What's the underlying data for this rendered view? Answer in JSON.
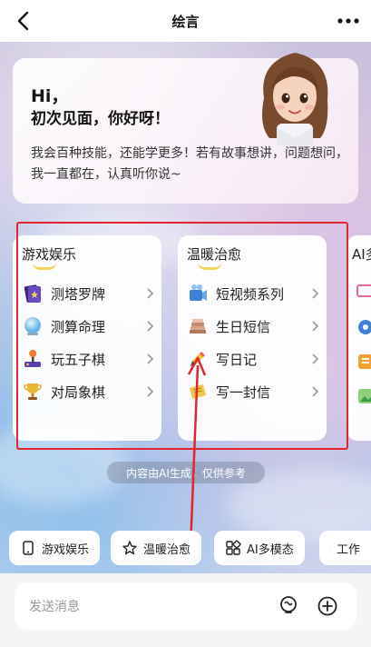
{
  "header": {
    "title": "绘言"
  },
  "greeting": {
    "hi": "Hi，",
    "meet": "初次见面，你好呀！",
    "intro": "我会百种技能，还能学更多！若有故事想讲，问题想问，我一直都在，认真听你说~"
  },
  "cards": [
    {
      "title": "游戏娱乐",
      "items": [
        {
          "label": "测塔罗牌",
          "icon": "tarot-icon"
        },
        {
          "label": "测算命理",
          "icon": "crystal-ball-icon"
        },
        {
          "label": "玩五子棋",
          "icon": "joystick-icon"
        },
        {
          "label": "对局象棋",
          "icon": "trophy-icon"
        }
      ]
    },
    {
      "title": "温暖治愈",
      "items": [
        {
          "label": "短视频系列",
          "icon": "video-icon"
        },
        {
          "label": "生日短信",
          "icon": "books-icon"
        },
        {
          "label": "写日记",
          "icon": "pencil-icon"
        },
        {
          "label": "写一封信",
          "icon": "ticket-icon"
        }
      ]
    }
  ],
  "partial_card": {
    "title": "AI多"
  },
  "disclaimer": "内容由AI生成，仅供参考",
  "chips": [
    {
      "label": "游戏娱乐",
      "icon": "phone-icon"
    },
    {
      "label": "温暖治愈",
      "icon": "star-icon"
    },
    {
      "label": "AI多模态",
      "icon": "grid-icon"
    },
    {
      "label": "工作",
      "icon": "document-icon"
    }
  ],
  "composer": {
    "placeholder": "发送消息"
  },
  "colors": {
    "highlight": "#e0262c",
    "accent": "#f2d45a"
  }
}
